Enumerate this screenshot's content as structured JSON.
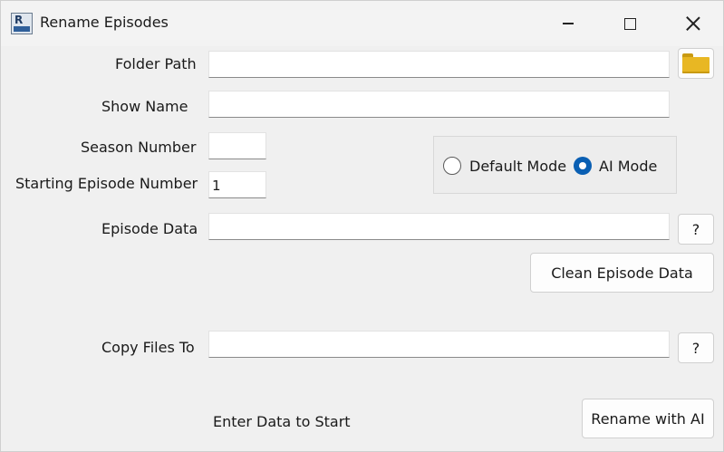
{
  "window": {
    "title": "Rename Episodes",
    "app_icon_letter": "R"
  },
  "form": {
    "folder_path": {
      "label": "Folder Path",
      "value": ""
    },
    "show_name": {
      "label": "Show Name",
      "value": ""
    },
    "season_number": {
      "label": "Season Number",
      "value": ""
    },
    "starting_episode_number": {
      "label": "Starting Episode Number",
      "value": "1"
    },
    "episode_data": {
      "label": "Episode Data",
      "value": "",
      "help_button": "?"
    },
    "copy_files_to": {
      "label": "Copy Files To",
      "value": "",
      "help_button": "?"
    }
  },
  "mode": {
    "options": [
      {
        "label": "Default Mode",
        "selected": false
      },
      {
        "label": "AI Mode",
        "selected": true
      }
    ]
  },
  "buttons": {
    "clean_episode_data": "Clean Episode Data",
    "rename": "Rename with AI"
  },
  "status": "Enter Data to Start",
  "colors": {
    "accent": "#0a5fb3",
    "folder": "#e8b723"
  }
}
